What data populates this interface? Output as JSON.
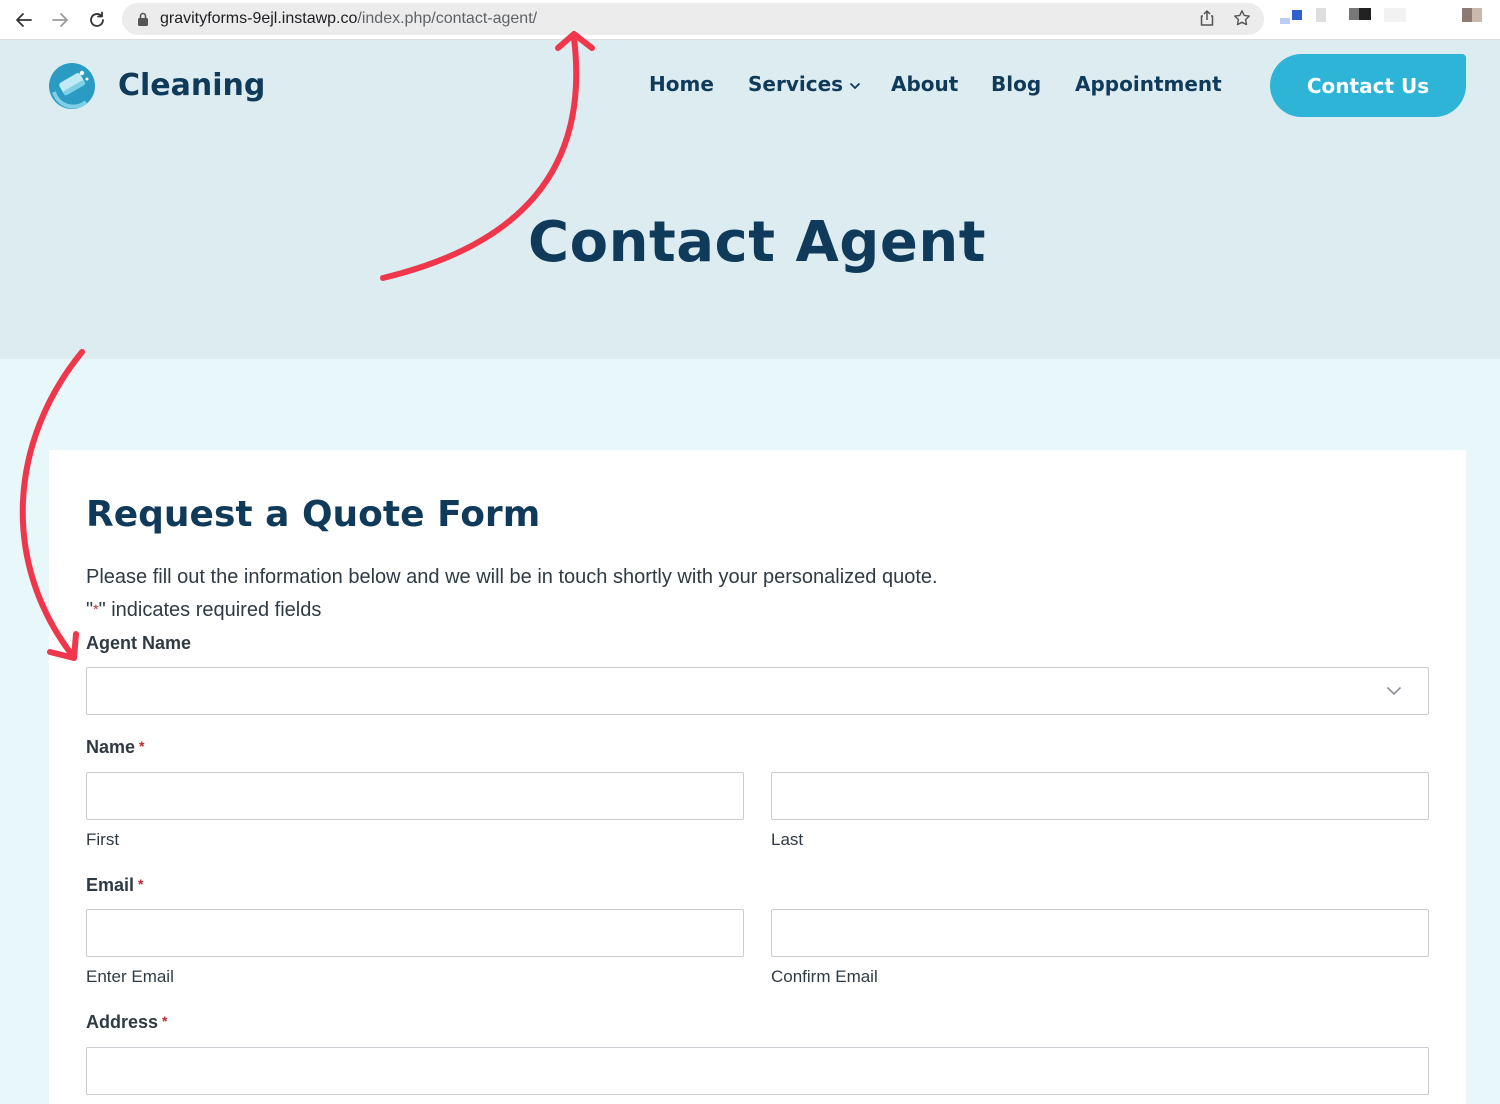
{
  "browser": {
    "url_host": "gravityforms-9ejl.instawp.co",
    "url_path": "/index.php/contact-agent/"
  },
  "site": {
    "brand": "Cleaning",
    "nav": [
      {
        "label": "Home"
      },
      {
        "label": "Services"
      },
      {
        "label": "About"
      },
      {
        "label": "Blog"
      },
      {
        "label": "Appointment"
      }
    ],
    "cta": "Contact Us",
    "page_title": "Contact Agent"
  },
  "form": {
    "title": "Request a Quote Form",
    "description": "Please fill out the information below and we will be in touch shortly with your personalized quote.",
    "required_note_prefix": "\"",
    "required_note_star": "*",
    "required_note_suffix": "\" indicates required fields",
    "agent_label": "Agent Name",
    "agent_value": "",
    "name_label": "Name",
    "name_first_sub": "First",
    "name_last_sub": "Last",
    "email_label": "Email",
    "email_enter_sub": "Enter Email",
    "email_confirm_sub": "Confirm Email",
    "address_label": "Address",
    "required_marker": "*"
  },
  "colors": {
    "brand_dark": "#103a5a",
    "accent": "#2db4d6",
    "annotation": "#f0364a",
    "required": "#c0262d"
  }
}
